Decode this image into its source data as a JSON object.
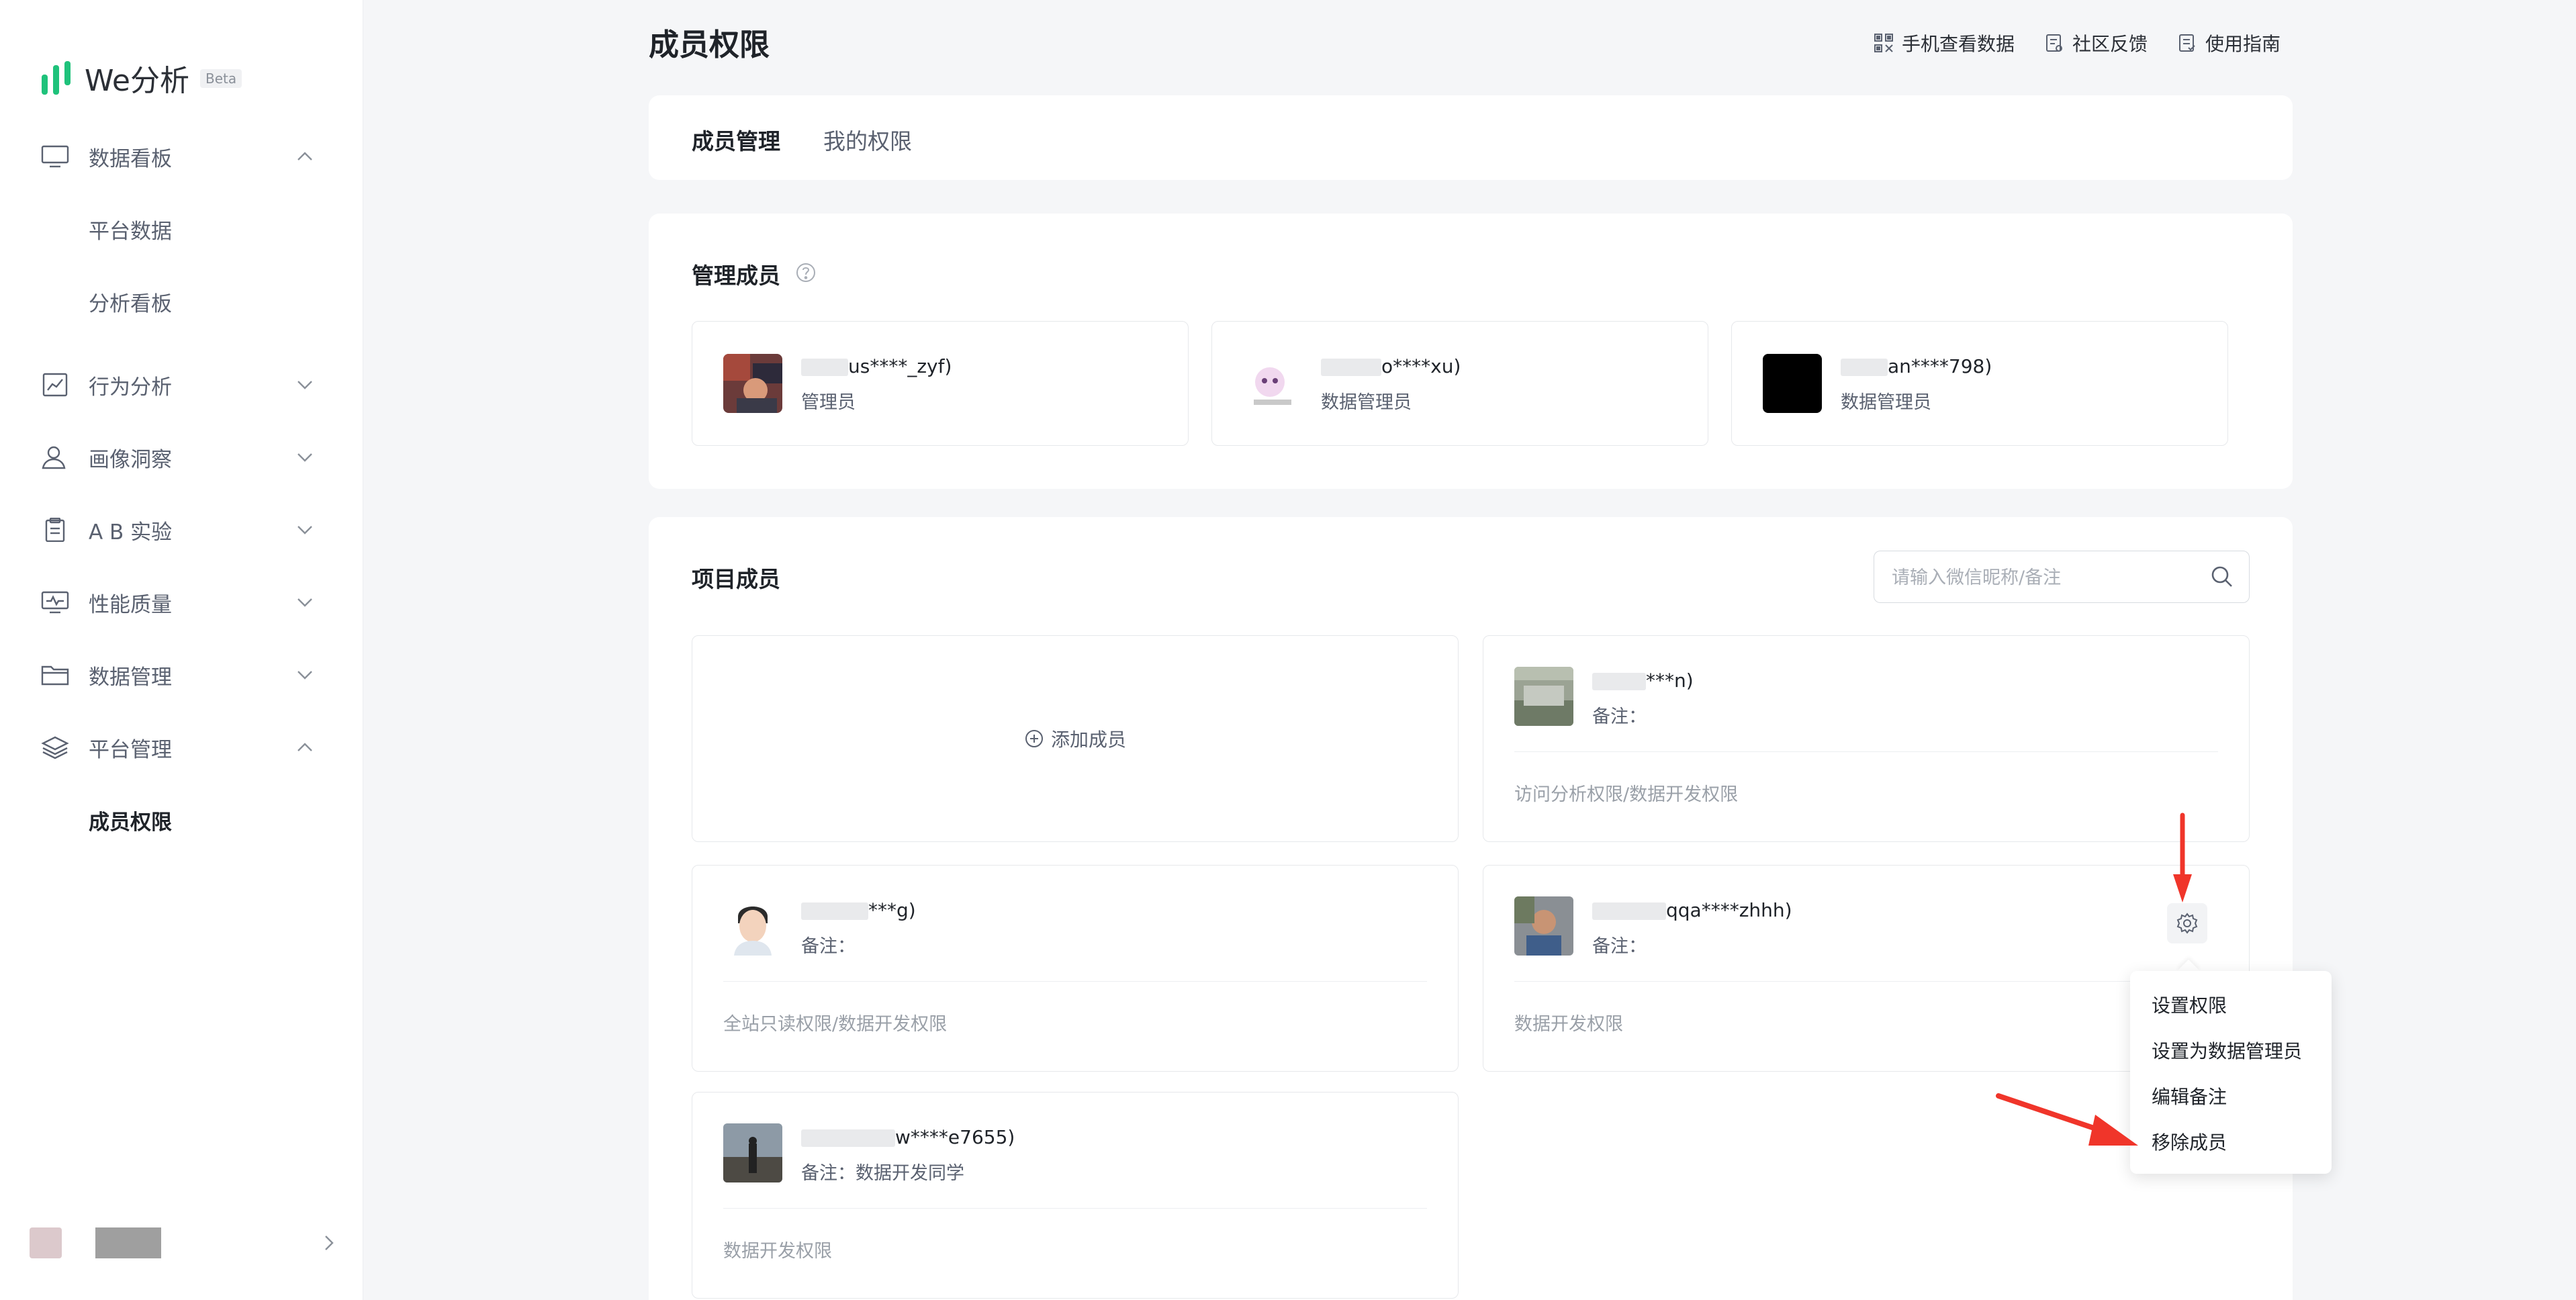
{
  "brand": {
    "name": "We分析",
    "badge": "Beta",
    "accent": "#1fc27b"
  },
  "sidebar": {
    "items": [
      {
        "label": "数据看板",
        "icon": "monitor-icon",
        "expanded": true
      },
      {
        "label": "平台数据",
        "sub": true
      },
      {
        "label": "分析看板",
        "sub": true
      },
      {
        "label": "行为分析",
        "icon": "line-chart-icon",
        "expanded": false
      },
      {
        "label": "画像洞察",
        "icon": "user-portrait-icon",
        "expanded": false
      },
      {
        "label": "A B 实验",
        "icon": "clipboard-icon",
        "expanded": false
      },
      {
        "label": "性能质量",
        "icon": "performance-monitor-icon",
        "expanded": false
      },
      {
        "label": "数据管理",
        "icon": "folder-icon",
        "expanded": false
      },
      {
        "label": "平台管理",
        "icon": "layers-icon",
        "expanded": true
      },
      {
        "label": "成员权限",
        "sub": true,
        "active": true
      }
    ]
  },
  "header": {
    "title": "成员权限",
    "links": [
      {
        "label": "手机查看数据",
        "icon": "qrcode-icon"
      },
      {
        "label": "社区反馈",
        "icon": "feedback-icon"
      },
      {
        "label": "使用指南",
        "icon": "guide-icon"
      }
    ]
  },
  "tabs": [
    {
      "label": "成员管理",
      "active": true
    },
    {
      "label": "我的权限",
      "active": false
    }
  ],
  "admins": {
    "title": "管理成员",
    "members": [
      {
        "name": "us****_zyf)",
        "role": "管理员"
      },
      {
        "name": "o****xu)",
        "role": "数据管理员"
      },
      {
        "name": "an****798)",
        "role": "数据管理员"
      }
    ]
  },
  "project": {
    "title": "项目成员",
    "search_placeholder": "请输入微信昵称/备注",
    "add_label": "添加成员",
    "members": [
      {
        "name": "***n)",
        "note_label": "备注：",
        "note": "",
        "permissions": "访问分析权限/数据开发权限"
      },
      {
        "name": "***g)",
        "note_label": "备注：",
        "note": "",
        "permissions": "全站只读权限/数据开发权限"
      },
      {
        "name": "qqa****zhhh)",
        "note_label": "备注：",
        "note": "",
        "permissions": "数据开发权限"
      },
      {
        "name": "w****e7655)",
        "note_label": "备注：",
        "note": "数据开发同学",
        "permissions": "数据开发权限"
      }
    ]
  },
  "context_menu": {
    "items": [
      "设置权限",
      "设置为数据管理员",
      "编辑备注",
      "移除成员"
    ]
  },
  "annotation_color": "#f0352a"
}
